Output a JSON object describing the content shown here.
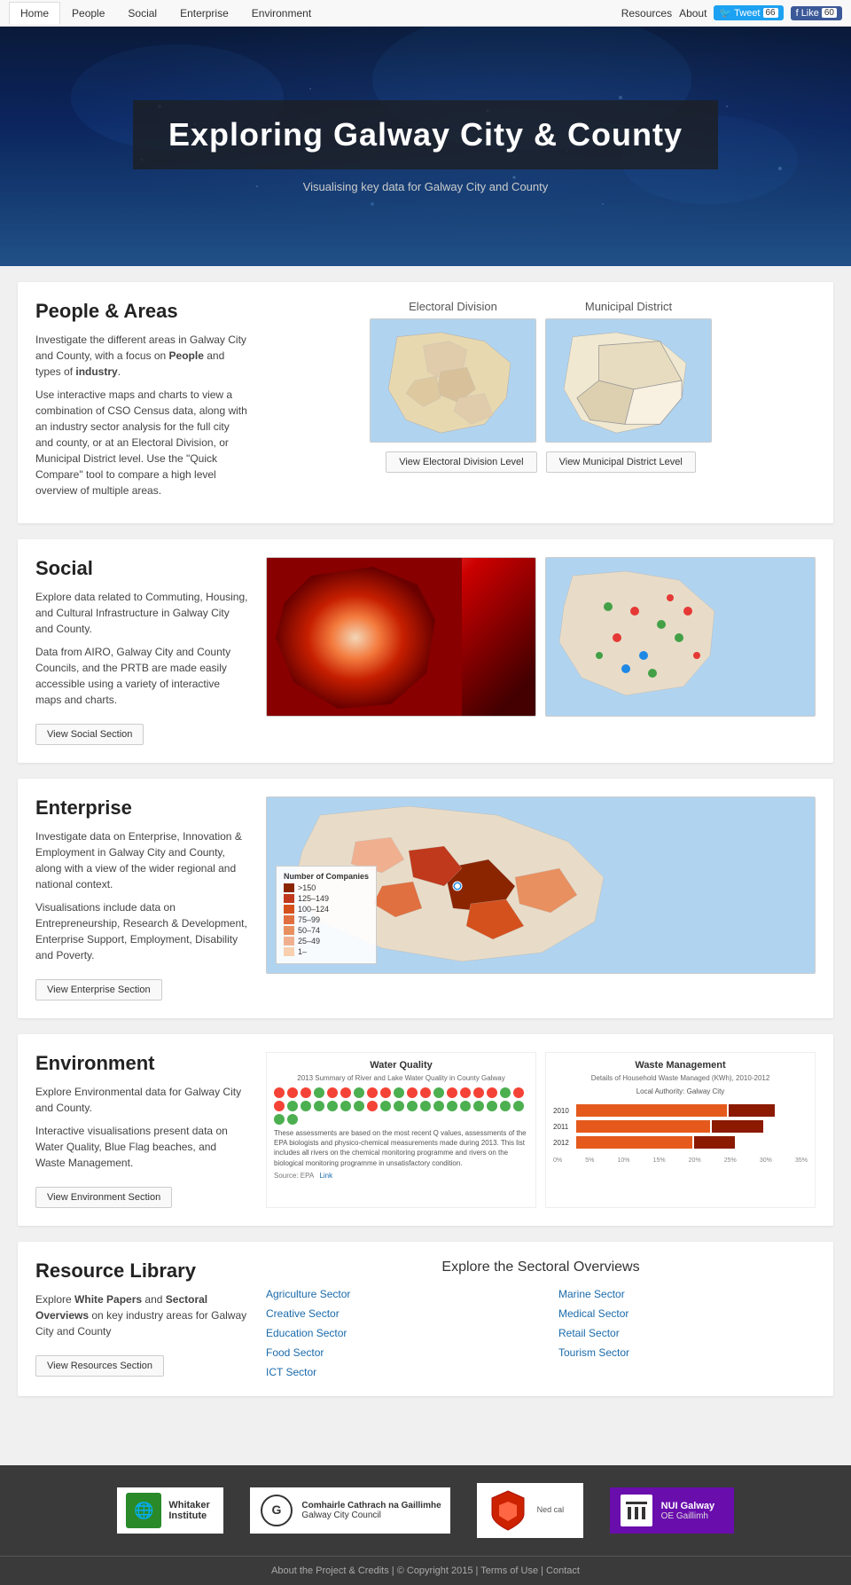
{
  "nav": {
    "links": [
      "Home",
      "People",
      "Social",
      "Enterprise",
      "Environment"
    ],
    "right_links": [
      "Resources",
      "About"
    ],
    "tweet_label": "Tweet",
    "tweet_count": "66",
    "like_label": "Like",
    "like_count": "60"
  },
  "hero": {
    "title": "Exploring Galway City & County",
    "subtitle": "Visualising key data for Galway City and County"
  },
  "people": {
    "title": "People & Areas",
    "desc1": "Investigate the different areas in Galway City and County, with a focus on People and types of industry.",
    "desc2": "Use interactive maps and charts to view a combination of CSO Census data, along with an industry sector analysis for the full city and county, or at an Electoral Division, or Municipal District level. Use the \"Quick Compare\" tool to compare a high level overview of multiple areas.",
    "map1_label": "Electoral Division",
    "map2_label": "Municipal District",
    "btn1": "View Electoral Division Level",
    "btn2": "View Municipal District Level"
  },
  "social": {
    "title": "Social",
    "desc1": "Explore data related to Commuting, Housing, and Cultural Infrastructure in Galway City and County.",
    "desc2": "Data from AIRO, Galway City and County Councils, and the PRTB are made easily accessible using a variety of interactive maps and charts.",
    "btn": "View Social Section"
  },
  "enterprise": {
    "title": "Enterprise",
    "desc1": "Investigate data on Enterprise, Innovation & Employment in Galway City and County, along with a view of the wider regional and national context.",
    "desc2": "Visualisations include data on Entrepreneurship, Research & Development, Enterprise Support, Employment, Disability and Poverty.",
    "btn": "View Enterprise Section",
    "legend_title": "Number of Companies",
    "legend_items": [
      {
        "color": "#8b2500",
        "label": ">150"
      },
      {
        "color": "#c0391c",
        "label": "125–149"
      },
      {
        "color": "#d4511e",
        "label": "100–124"
      },
      {
        "color": "#e07040",
        "label": "75–99"
      },
      {
        "color": "#e89060",
        "label": "50–74"
      },
      {
        "color": "#f0b090",
        "label": "25–49"
      },
      {
        "color": "#f8d0b0",
        "label": "1–"
      }
    ]
  },
  "environment": {
    "title": "Environment",
    "desc1": "Explore Environmental data for Galway City and County.",
    "desc2": "Interactive visualisations present data on Water Quality, Blue Flag beaches, and Waste Management.",
    "btn": "View Environment Section",
    "water_quality": {
      "title": "Water Quality",
      "subtitle": "2013 Summary of River and Lake Water Quality in County Galway",
      "note": "These assessments are based on the most recent Q values, assessments of the EPA biologists and physico-chemical measurements made during 2013. This list includes all rivers on the chemical monitoring programme and rivers on the biological monitoring programme in unsatisfactory condition.",
      "source": "Source: EPA",
      "link": "Link"
    },
    "waste_management": {
      "title": "Waste Management",
      "subtitle": "Details of Household Waste Managed (KWh), 2010-2012",
      "authority": "Local Authority: Galway City",
      "years": [
        "2010",
        "2011",
        "2012"
      ],
      "axis": [
        "0%",
        "5%",
        "10%",
        "15%",
        "20%",
        "25%",
        "30%",
        "35%"
      ]
    }
  },
  "resources": {
    "title": "Resource Library",
    "desc1": "Explore White Papers and Sectoral Overviews on key industry areas for Galway City and County",
    "btn": "View Resources Section",
    "explore_title": "Explore the Sectoral Overviews",
    "sectors_left": [
      "Agriculture Sector",
      "Creative Sector",
      "Education Sector",
      "Food Sector",
      "ICT Sector"
    ],
    "sectors_right": [
      "Marine Sector",
      "Medical Sector",
      "Retail Sector",
      "Tourism Sector"
    ]
  },
  "footer": {
    "logos": [
      {
        "name": "Whitaker Institute",
        "line2": "Institute"
      },
      {
        "name": "Comhairle Cathrach na Gaillimhe Galway City Council"
      },
      {
        "name": ""
      },
      {
        "name": "NUI Galway OE Gaillimh"
      }
    ],
    "bottom_links": [
      "About the Project & Credits",
      "Copyright 2015",
      "Terms of Use",
      "Contact"
    ]
  }
}
